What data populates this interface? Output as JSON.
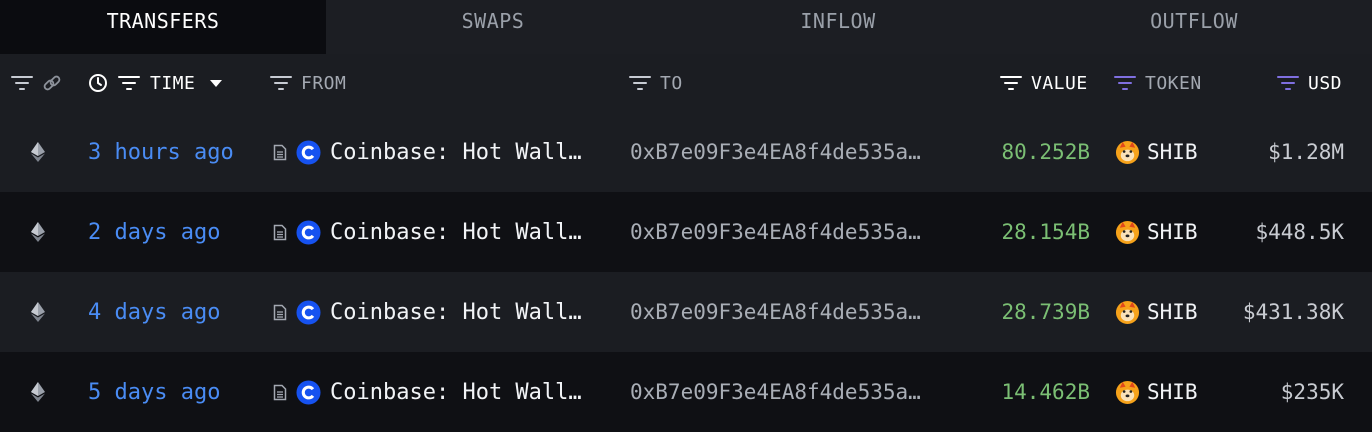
{
  "tabs": [
    {
      "label": "TRANSFERS",
      "active": true
    },
    {
      "label": "SWAPS",
      "active": false
    },
    {
      "label": "INFLOW",
      "active": false
    },
    {
      "label": "OUTFLOW",
      "active": false
    }
  ],
  "columns": {
    "time": "TIME",
    "from": "FROM",
    "to": "TO",
    "value": "VALUE",
    "token": "TOKEN",
    "usd": "USD"
  },
  "icons": {
    "chain": "ethereum-icon",
    "entity": "coinbase-logo-icon",
    "token": "shiba-inu-token-icon",
    "note": "document-icon"
  },
  "colors": {
    "time_link": "#4a8cf4",
    "value_green": "#7bbf74",
    "filter_purple": "#7f6fe0",
    "coinbase_blue": "#1652f0"
  },
  "rows": [
    {
      "time": "3 hours ago",
      "from": "Coinbase: Hot Wall…",
      "to": "0xB7e09F3e4EA8f4de535a…",
      "value": "80.252B",
      "token": "SHIB",
      "usd": "$1.28M"
    },
    {
      "time": "2 days ago",
      "from": "Coinbase: Hot Wall…",
      "to": "0xB7e09F3e4EA8f4de535a…",
      "value": "28.154B",
      "token": "SHIB",
      "usd": "$448.5K"
    },
    {
      "time": "4 days ago",
      "from": "Coinbase: Hot Wall…",
      "to": "0xB7e09F3e4EA8f4de535a…",
      "value": "28.739B",
      "token": "SHIB",
      "usd": "$431.38K"
    },
    {
      "time": "5 days ago",
      "from": "Coinbase: Hot Wall…",
      "to": "0xB7e09F3e4EA8f4de535a…",
      "value": "14.462B",
      "token": "SHIB",
      "usd": "$235K"
    }
  ]
}
